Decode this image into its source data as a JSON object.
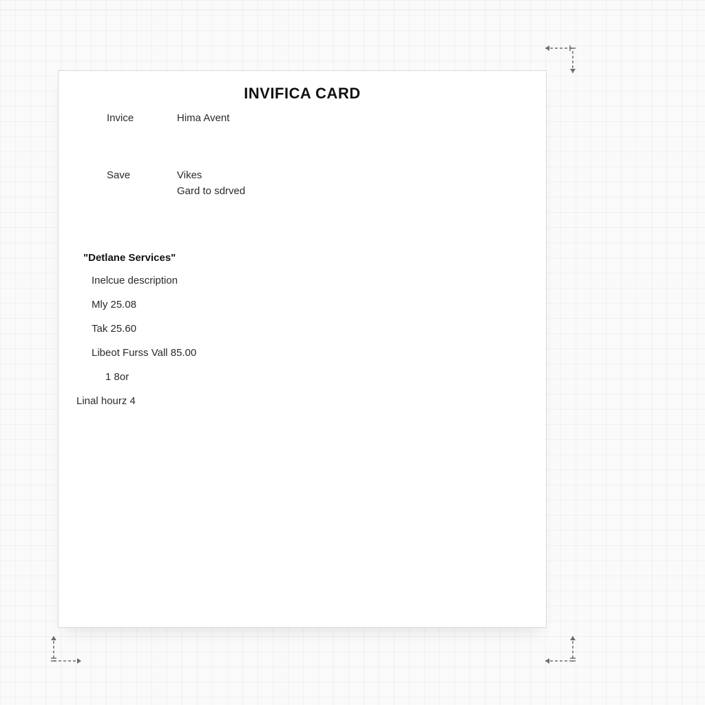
{
  "card": {
    "title": "INVIFICA CARD",
    "fields": {
      "invoice": {
        "label": "Invice",
        "value": "Hima Avent"
      },
      "save": {
        "label": "Save",
        "value": "Vikes",
        "sub": "Gard to sdrved"
      }
    },
    "section_title": "\"Detlane Services\"",
    "lines": [
      "Inelcue description",
      "Mly 25.08",
      "Tak 25.60",
      "Libeot Furss Vall 85.00",
      "1 8or",
      "Linal hourz 4"
    ]
  }
}
